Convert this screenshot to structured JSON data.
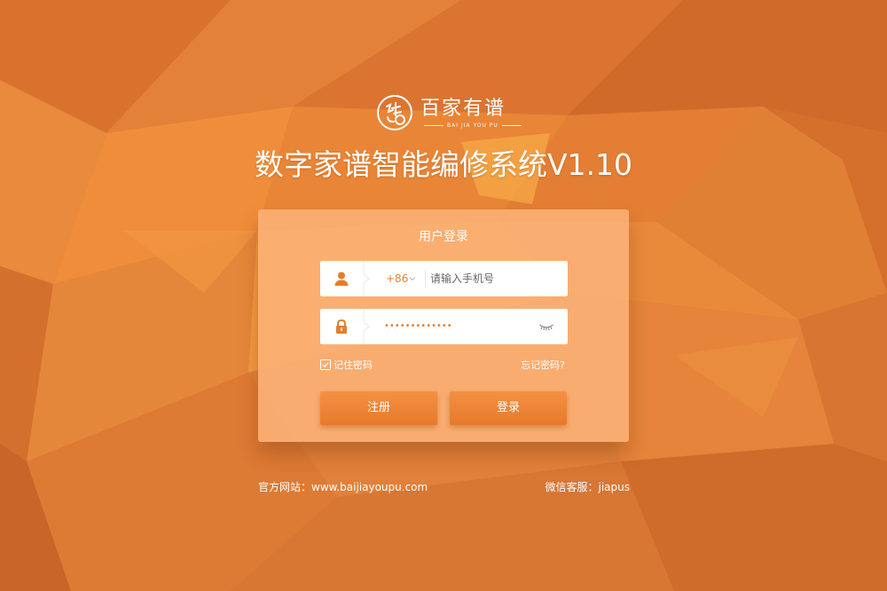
{
  "brand": {
    "logo_text": "百家有谱",
    "logo_subtext": "BAI JIA YOU PU"
  },
  "app_title": "数字家谱智能编修系统V1.10",
  "login": {
    "heading": "用户登录",
    "country_code": "+86",
    "phone_placeholder": "请输入手机号",
    "password_masked": "•••••••••••••",
    "remember_label": "记住密码",
    "remember_checked": true,
    "forgot_label": "忘记密码?",
    "register_label": "注册",
    "login_label": "登录"
  },
  "footer": {
    "website": "官方网站：www.baijiayoupu.com",
    "wechat": "微信客服：jiapus"
  },
  "icons": {
    "user": "user-icon",
    "lock": "lock-icon",
    "eye": "eye-closed-icon",
    "chevron": "chevron-down-icon",
    "check": "check-icon"
  },
  "colors": {
    "accent": "#e37f2c",
    "button": "#ee8535",
    "card": "#f9b07a",
    "background": "#e07a2e"
  }
}
